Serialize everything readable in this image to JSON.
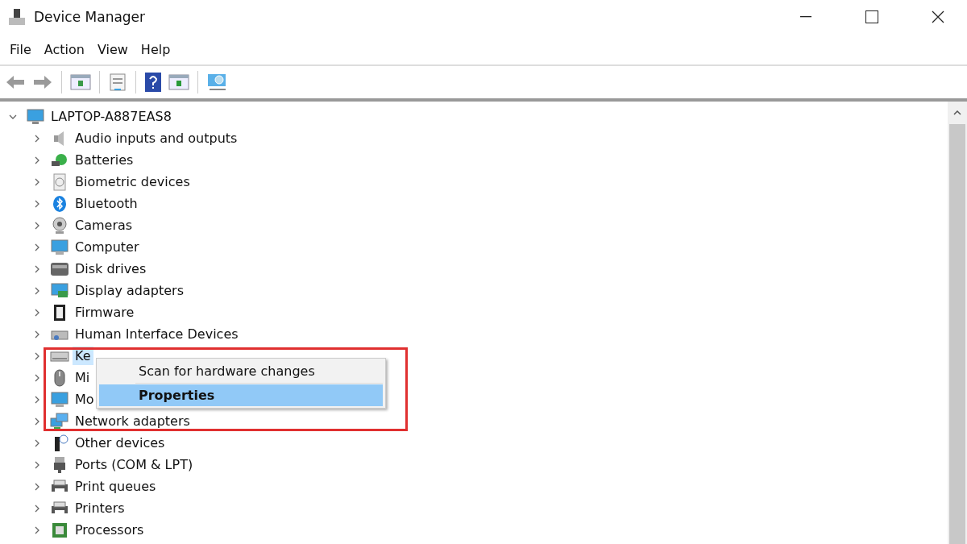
{
  "window": {
    "title": "Device Manager"
  },
  "menu_bar": [
    "File",
    "Action",
    "View",
    "Help"
  ],
  "tree": {
    "label": "LAPTOP-A887EAS8",
    "expanded": true,
    "selected": false,
    "children": [
      {
        "label": "Audio inputs and outputs",
        "expanded": false,
        "selected": false
      },
      {
        "label": "Batteries",
        "expanded": false,
        "selected": false
      },
      {
        "label": "Biometric devices",
        "expanded": false,
        "selected": false
      },
      {
        "label": "Bluetooth",
        "expanded": false,
        "selected": false
      },
      {
        "label": "Cameras",
        "expanded": false,
        "selected": false
      },
      {
        "label": "Computer",
        "expanded": false,
        "selected": false
      },
      {
        "label": "Disk drives",
        "expanded": false,
        "selected": false
      },
      {
        "label": "Display adapters",
        "expanded": false,
        "selected": false
      },
      {
        "label": "Firmware",
        "expanded": false,
        "selected": false
      },
      {
        "label": "Human Interface Devices",
        "expanded": false,
        "selected": false
      },
      {
        "label": "Ke",
        "expanded": false,
        "selected": true
      },
      {
        "label": "Mi",
        "expanded": false,
        "selected": false
      },
      {
        "label": "Mo",
        "expanded": false,
        "selected": false
      },
      {
        "label": "Network adapters",
        "expanded": false,
        "selected": false
      },
      {
        "label": "Other devices",
        "expanded": false,
        "selected": false
      },
      {
        "label": "Ports (COM & LPT)",
        "expanded": false,
        "selected": false
      },
      {
        "label": "Print queues",
        "expanded": false,
        "selected": false
      },
      {
        "label": "Printers",
        "expanded": false,
        "selected": false
      },
      {
        "label": "Processors",
        "expanded": false,
        "selected": false
      }
    ]
  },
  "context_menu": [
    {
      "label": "Scan for hardware changes",
      "selected": false
    },
    {
      "label": "Properties",
      "selected": true
    }
  ]
}
